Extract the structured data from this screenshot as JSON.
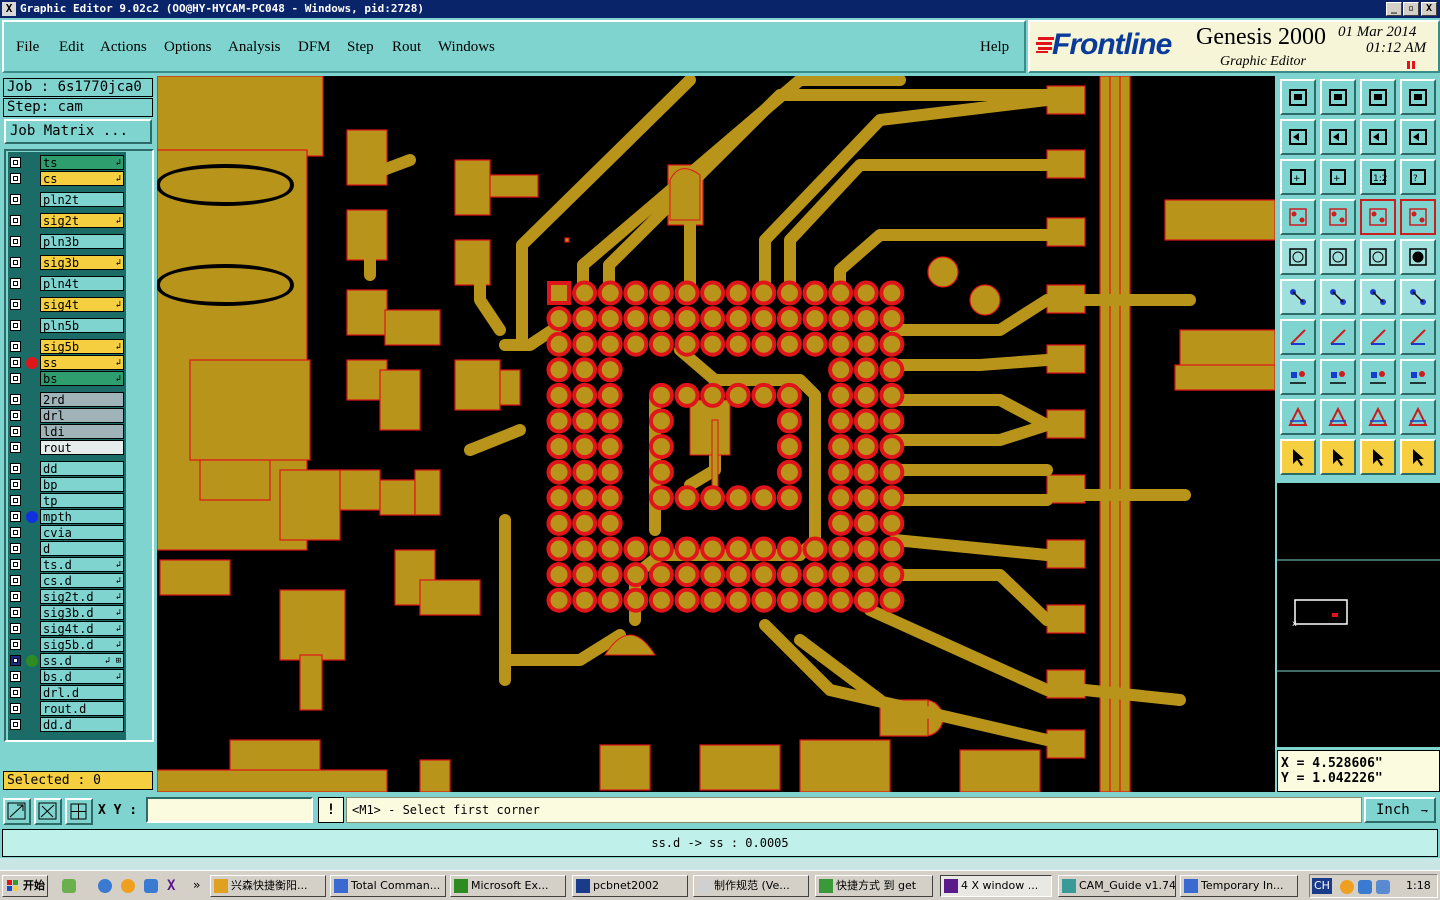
{
  "window": {
    "title": "Graphic Editor 9.02c2 (OO@HY-HYCAM-PC048 - Windows, pid:2728)",
    "icon_glyph": "X",
    "controls": [
      "_",
      "▫",
      "X"
    ]
  },
  "menu": {
    "items": [
      "File",
      "Edit",
      "Actions",
      "Options",
      "Analysis",
      "DFM",
      "Step",
      "Rout",
      "Windows"
    ],
    "help": "Help"
  },
  "brand": {
    "logo": "Frontline",
    "product": "Genesis 2000",
    "subtitle": "Graphic Editor",
    "date": "01 Mar 2014",
    "time": "01:12 AM"
  },
  "job": {
    "job_line": "Job : 6s1770jca0",
    "step_line": "Step: cam",
    "matrix_button": "Job Matrix ..."
  },
  "layers": [
    {
      "name": "ts",
      "color": "#2e9e6e",
      "mark": "↲"
    },
    {
      "name": "cs",
      "color": "#f5cf3f",
      "mark": "↲"
    },
    {
      "name": "pln2t",
      "color": "#7fd4cf",
      "mark": ""
    },
    {
      "name": "sig2t",
      "color": "#f5cf3f",
      "mark": "↲"
    },
    {
      "name": "pln3b",
      "color": "#7fd4cf",
      "mark": ""
    },
    {
      "name": "sig3b",
      "color": "#f5cf3f",
      "mark": "↲"
    },
    {
      "name": "pln4t",
      "color": "#7fd4cf",
      "mark": ""
    },
    {
      "name": "sig4t",
      "color": "#f5cf3f",
      "mark": "↲"
    },
    {
      "name": "pln5b",
      "color": "#7fd4cf",
      "mark": ""
    },
    {
      "name": "sig5b",
      "color": "#f5cf3f",
      "mark": "↲"
    },
    {
      "name": "ss",
      "color": "#f5cf3f",
      "mark": "↲",
      "dot": "#e0151a"
    },
    {
      "name": "bs",
      "color": "#2e9e6e",
      "mark": "↲"
    },
    {
      "name": "2rd",
      "color": "#9fb3b8",
      "mark": ""
    },
    {
      "name": "drl",
      "color": "#9fb3b8",
      "mark": ""
    },
    {
      "name": "ldi",
      "color": "#9fb3b8",
      "mark": ""
    },
    {
      "name": "rout",
      "color": "#e6ecec",
      "mark": ""
    },
    {
      "name": "dd",
      "color": "#7fd4cf",
      "mark": ""
    },
    {
      "name": "bp",
      "color": "#7fd4cf",
      "mark": ""
    },
    {
      "name": "tp",
      "color": "#7fd4cf",
      "mark": ""
    },
    {
      "name": "mpth",
      "color": "#7fd4cf",
      "mark": "",
      "dot": "#1030e0"
    },
    {
      "name": "cvia",
      "color": "#7fd4cf",
      "mark": ""
    },
    {
      "name": "d",
      "color": "#7fd4cf",
      "mark": ""
    },
    {
      "name": "ts.d",
      "color": "#7fd4cf",
      "mark": "↲"
    },
    {
      "name": "cs.d",
      "color": "#7fd4cf",
      "mark": "↲"
    },
    {
      "name": "sig2t.d",
      "color": "#7fd4cf",
      "mark": "↲"
    },
    {
      "name": "sig3b.d",
      "color": "#7fd4cf",
      "mark": "↲"
    },
    {
      "name": "sig4t.d",
      "color": "#7fd4cf",
      "mark": "↲"
    },
    {
      "name": "sig5b.d",
      "color": "#7fd4cf",
      "mark": "↲"
    },
    {
      "name": "ss.d",
      "color": "#7fd4cf",
      "mark": "↲ ⊞",
      "dot": "#2e8b22",
      "checked": true
    },
    {
      "name": "bs.d",
      "color": "#7fd4cf",
      "mark": "↲"
    },
    {
      "name": "drl.d",
      "color": "#7fd4cf",
      "mark": ""
    },
    {
      "name": "rout.d",
      "color": "#7fd4cf",
      "mark": ""
    },
    {
      "name": "dd.d",
      "color": "#7fd4cf",
      "mark": ""
    }
  ],
  "selected": "Selected : 0",
  "coords": {
    "x": "X = 4.528606\"",
    "y": "Y = 1.042226\""
  },
  "input": {
    "xy_label": "X Y :",
    "xy_value": "",
    "excl": "!",
    "prompt": "<M1> - Select first corner",
    "unit": "Inch"
  },
  "status": "ss.d -> ss : 0.0005",
  "taskbar": {
    "start": "开始",
    "tasks": [
      "兴森快捷衡阳...",
      "Total Comman...",
      "Microsoft Ex...",
      "pcbnet2002",
      "制作规范 (Ve...",
      "快捷方式 到 get",
      "4 X window ...",
      "CAM_Guide v1.74",
      "Temporary In..."
    ],
    "tray_lang": "CH",
    "clock": "1:18"
  },
  "colors": {
    "copper": "#b8941a",
    "pad_fill": "#e0151a",
    "panel": "#7fd4cf",
    "canvas_bg": "#000000"
  }
}
